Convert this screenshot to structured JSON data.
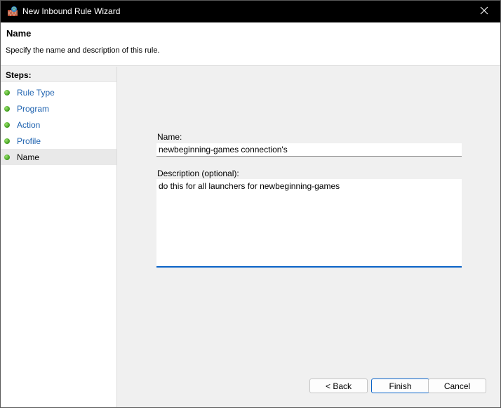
{
  "window": {
    "title": "New Inbound Rule Wizard",
    "app_icon": "firewall-icon",
    "close_icon": "close-icon"
  },
  "header": {
    "title": "Name",
    "description": "Specify the name and description of this rule."
  },
  "steps": {
    "heading": "Steps:",
    "items": [
      {
        "label": "Rule Type",
        "status": "complete"
      },
      {
        "label": "Program",
        "status": "complete"
      },
      {
        "label": "Action",
        "status": "complete"
      },
      {
        "label": "Profile",
        "status": "complete"
      },
      {
        "label": "Name",
        "status": "current"
      }
    ],
    "dot_color": "#3e9c1c",
    "link_color": "#1f63b0"
  },
  "form": {
    "name_label": "Name:",
    "name_value": "newbeginning-games connection's",
    "description_label": "Description (optional):",
    "description_value": "do this for all launchers for newbeginning-games"
  },
  "buttons": {
    "back": "< Back",
    "finish": "Finish",
    "cancel": "Cancel"
  },
  "colors": {
    "accent": "#0a63c7",
    "titlebar": "#000000"
  }
}
